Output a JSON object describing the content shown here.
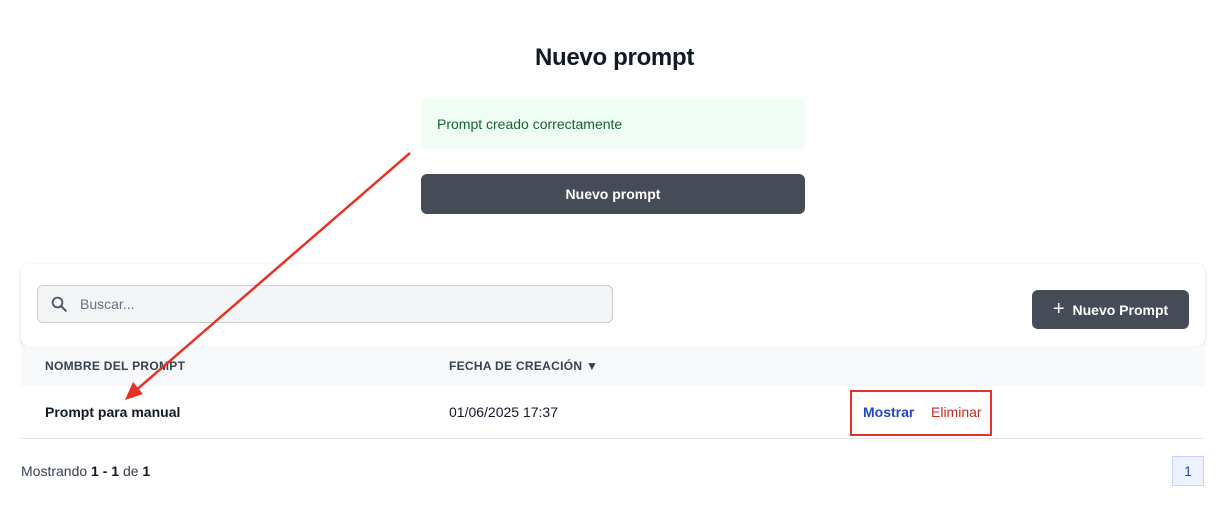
{
  "header": {
    "title": "Nuevo prompt"
  },
  "alert": {
    "message": "Prompt creado correctamente"
  },
  "primary_button": {
    "label": "Nuevo prompt"
  },
  "toolbar": {
    "search_placeholder": "Buscar...",
    "search_value": "",
    "new_button_label": "Nuevo Prompt",
    "new_button_icon": "plus-icon"
  },
  "table": {
    "columns": [
      "NOMBRE DEL PROMPT",
      "FECHA DE CREACIÓN ▼"
    ],
    "rows": [
      {
        "name": "Prompt para manual",
        "date": "01/06/2025 17:37",
        "action_show": "Mostrar",
        "action_delete": "Eliminar"
      }
    ]
  },
  "pagination": {
    "label_prefix": "Mostrando",
    "range": "1 - 1",
    "label_of": "de",
    "total": "1",
    "current_page": "1"
  },
  "annotations": {
    "arrow_color": "#e53425",
    "box_color": "#e53425"
  },
  "colors": {
    "dark_button": "#464b58",
    "success_bg": "#f0fdf4",
    "success_text": "#166534",
    "link_blue": "#2346c8",
    "link_red": "#c42b1c"
  }
}
